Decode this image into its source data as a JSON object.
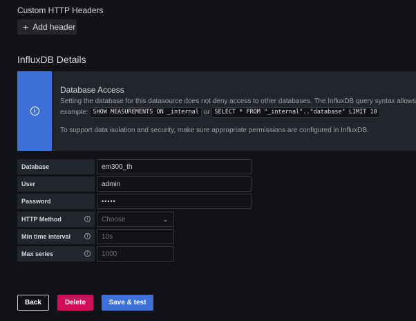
{
  "headers": {
    "title": "Custom HTTP Headers",
    "add_label": "Add header"
  },
  "influx": {
    "title": "InfluxDB Details"
  },
  "alert": {
    "title": "Database Access",
    "line1": "Setting the database for this datasource does not deny access to other databases. The InfluxDB query syntax allows",
    "example_prefix": "example:",
    "code1": "SHOW MEASUREMENTS ON _internal",
    "or": "or",
    "code2": "SELECT * FROM \"_internal\"..\"database\" LIMIT 10",
    "line3": "To support data isolation and security, make sure appropriate permissions are configured in InfluxDB.",
    "icon": "info-circle-icon"
  },
  "form": {
    "database": {
      "label": "Database",
      "value": "em300_th"
    },
    "user": {
      "label": "User",
      "value": "admin"
    },
    "password": {
      "label": "Password",
      "value": "•••••"
    },
    "http_method": {
      "label": "HTTP Method",
      "placeholder": "Choose"
    },
    "min_time_interval": {
      "label": "Min time interval",
      "placeholder": "10s"
    },
    "max_series": {
      "label": "Max series",
      "placeholder": "1000"
    }
  },
  "actions": {
    "back": "Back",
    "delete": "Delete",
    "save": "Save & test"
  },
  "colors": {
    "background": "#111217",
    "primary": "#3d71d9",
    "destructive": "#d10e5c"
  }
}
